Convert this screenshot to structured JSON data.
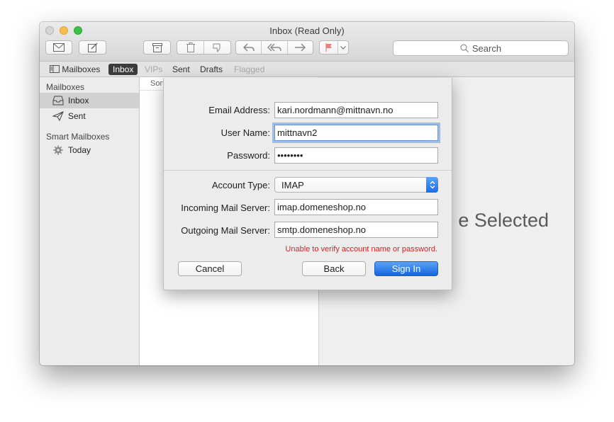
{
  "window": {
    "title": "Inbox (Read Only)"
  },
  "toolbar": {
    "search_label": "Search"
  },
  "favorites": {
    "mailboxes": "Mailboxes",
    "inbox": "Inbox",
    "vips": "VIPs",
    "sent": "Sent",
    "drafts": "Drafts",
    "flagged": "Flagged"
  },
  "sidebar": {
    "mailboxes_header": "Mailboxes",
    "smart_header": "Smart Mailboxes",
    "items": [
      {
        "label": "Inbox",
        "icon": "inbox-tray-icon"
      },
      {
        "label": "Sent",
        "icon": "paper-plane-icon"
      },
      {
        "label": "Today",
        "icon": "gear-icon"
      }
    ]
  },
  "message_list": {
    "sort_label": "Sort"
  },
  "viewer": {
    "placeholder": "e Selected"
  },
  "sheet": {
    "email_label": "Email Address:",
    "email_value": "kari.nordmann@mittnavn.no",
    "username_label": "User Name:",
    "username_value": "mittnavn2",
    "password_label": "Password:",
    "password_value": "••••••••",
    "account_type_label": "Account Type:",
    "account_type_value": "IMAP",
    "incoming_label": "Incoming Mail Server:",
    "incoming_value": "imap.domeneshop.no",
    "outgoing_label": "Outgoing Mail Server:",
    "outgoing_value": "smtp.domeneshop.no",
    "error": "Unable to verify account name or password.",
    "cancel": "Cancel",
    "back": "Back",
    "sign_in": "Sign In"
  },
  "colors": {
    "accent": "#1a6ee8",
    "error": "#d42222",
    "flag": "#f07c7c"
  }
}
